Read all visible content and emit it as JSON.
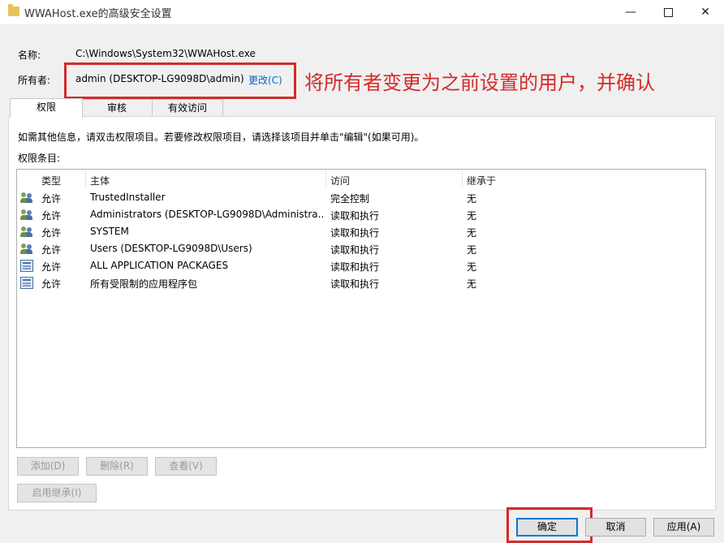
{
  "window": {
    "title": "WWAHost.exe的高级安全设置",
    "min_glyph": "—",
    "close_glyph": "✕"
  },
  "info": {
    "name_label": "名称:",
    "name_value": "C:\\Windows\\System32\\WWAHost.exe",
    "owner_label": "所有者:",
    "owner_value": "admin (DESKTOP-LG9098D\\admin)",
    "change_link": "更改(C)"
  },
  "annotation": {
    "text": "将所有者变更为之前设置的用户，并确认",
    "color": "#d42a2a"
  },
  "tabs": [
    {
      "label": "权限",
      "active": true
    },
    {
      "label": "审核",
      "active": false
    },
    {
      "label": "有效访问",
      "active": false
    }
  ],
  "permissions": {
    "instruction": "如需其他信息，请双击权限项目。若要修改权限项目，请选择该项目并单击\"编辑\"(如果可用)。",
    "entries_label": "权限条目:",
    "columns": {
      "type": "类型",
      "principal": "主体",
      "access": "访问",
      "inherited": "继承于"
    },
    "rows": [
      {
        "icon": "users-icon",
        "type": "允许",
        "principal": "TrustedInstaller",
        "access": "完全控制",
        "inherited": "无"
      },
      {
        "icon": "users-icon",
        "type": "允许",
        "principal": "Administrators (DESKTOP-LG9098D\\Administra...",
        "access": "读取和执行",
        "inherited": "无"
      },
      {
        "icon": "users-icon",
        "type": "允许",
        "principal": "SYSTEM",
        "access": "读取和执行",
        "inherited": "无"
      },
      {
        "icon": "users-icon",
        "type": "允许",
        "principal": "Users (DESKTOP-LG9098D\\Users)",
        "access": "读取和执行",
        "inherited": "无"
      },
      {
        "icon": "package-icon",
        "type": "允许",
        "principal": "ALL APPLICATION PACKAGES",
        "access": "读取和执行",
        "inherited": "无"
      },
      {
        "icon": "package-icon",
        "type": "允许",
        "principal": "所有受限制的应用程序包",
        "access": "读取和执行",
        "inherited": "无"
      }
    ],
    "add_button": "添加(D)",
    "remove_button": "删除(R)",
    "view_button": "查看(V)",
    "enable_inheritance_button": "启用继承(I)"
  },
  "footer": {
    "ok": "确定",
    "cancel": "取消",
    "apply": "应用(A)"
  }
}
